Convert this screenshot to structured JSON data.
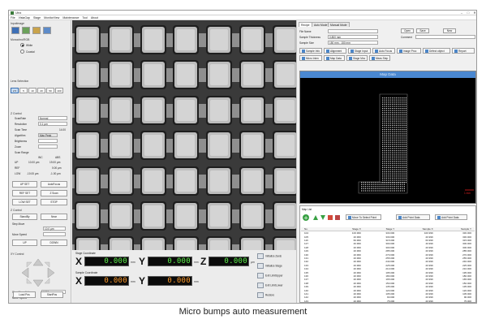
{
  "window": {
    "title": "Ulea",
    "controls": [
      "–",
      "□",
      "✕"
    ]
  },
  "menu": [
    "File",
    "VistaGap",
    "Stage",
    "MonitorView",
    "Maintenance",
    "Tool",
    "About"
  ],
  "left": {
    "input_image": "InputImage",
    "monochrome": "Monochro/RGB",
    "white": "White",
    "coaxial": "Coaxial",
    "lens_selection": "Lens Selection",
    "lenses": [
      "2.5",
      "5",
      "10",
      "20",
      "50",
      "100"
    ],
    "z_control": "Z Control",
    "scan_rate_label": "ScanRate",
    "scan_rate_value": "Normal",
    "resolution_label": "Resolution",
    "resolution_value": "0.1 µm",
    "scan_time_label": "Scan Time",
    "scan_time_value": "14.00",
    "algorithm_label": "Algorithm",
    "algorithm_value": "Max Peak",
    "brightness_label": "Brightness",
    "zoom_label": "Zoom",
    "scan_range_label": "Scan Range",
    "inc_label": "INC",
    "abs_label": "ABS",
    "up_label": "UP",
    "up_inc": "10.00 µm",
    "up_abs": "19.00 µm",
    "ref_label": "REF",
    "ref_inc": "",
    "ref_abs": "0.00 µm",
    "low_label": "LOW",
    "low_inc": "-10.00 µm",
    "low_abs": "-1.00 µm",
    "up_set": "UP SET",
    "auto_focus": "AutoFocus",
    "ref_set": "REF SET",
    "z_scan": "Z Scan",
    "low_set": "LOW SET",
    "stop": "STOP",
    "z_ctrl2": "Z Control",
    "standby": "StandBy",
    "near": "Near",
    "step_move": "Step Move",
    "step_move_value": "10.0 µm",
    "move_speed": "Move Speed",
    "up": "UP",
    "down": "DOWN",
    "xy_control": "XY Control",
    "xy_step_label": "Step Move Value",
    "xy_step_value": "1000 µm",
    "xy_speed_label": "Move Speed",
    "load_pos": "Load Pos",
    "start_pos": "StartPos"
  },
  "coords": {
    "stage_title": "Stage Coordinate",
    "sample_title": "Sample Coordinate",
    "x": "X",
    "y": "Y",
    "z": "Z",
    "stage_x": "0.000",
    "stage_y": "0.000",
    "stage_z": "0.000",
    "sample_x": "0.000",
    "sample_y": "0.000",
    "unit_mm": "mm",
    "unit_um": "µm",
    "buttons": [
      "Initialize Zaxis",
      "Initialize Stage",
      "Exit LimitUpper",
      "Exit LimitLower",
      "Restore"
    ]
  },
  "right": {
    "tabs": [
      "Recipe",
      "Auto Mode",
      "Manual Mode"
    ],
    "file_name_label": "File Name",
    "sample_thickness_label": "Sample Thickness",
    "sample_thickness_value": "0.800 mm",
    "sample_size_label": "Sample Size",
    "sample_size_value": "150 mm - 150 mm",
    "open": "Open",
    "save": "Save",
    "new": "New",
    "comment_label": "Comment",
    "toolbar1": [
      "Sample Info",
      "Alignment",
      "Stage Input",
      "Auto Focus",
      "Image Proc",
      "Defect object",
      "Report"
    ],
    "toolbar2": [
      "Micro Inten",
      "Map Data",
      "Stage Mov",
      "Meas Step"
    ],
    "map_header": "Map Data",
    "scale_label": "1 mm",
    "map_list": "Map List",
    "move_select": "Move To Select Point",
    "add_point_data": "Add Point Data",
    "add_point_data2": "Add Point Data",
    "columns": [
      "No.",
      "Stage X",
      "Stage Y",
      "Sample X",
      "Sample Y"
    ],
    "rows": [
      [
        "104",
        "100.999",
        "330.000",
        "100.999",
        "330.000"
      ],
      [
        "105",
        "20.999",
        "330.000",
        "20.999",
        "330.000"
      ],
      [
        "116",
        "60.999",
        "315.000",
        "60.999",
        "315.000"
      ],
      [
        "127",
        "40.999",
        "300.000",
        "40.999",
        "300.000"
      ],
      [
        "128",
        "20.999",
        "300.000",
        "20.999",
        "300.000"
      ],
      [
        "129",
        "20.999",
        "285.000",
        "20.999",
        "285.000"
      ],
      [
        "130",
        "20.999",
        "270.000",
        "20.999",
        "270.000"
      ],
      [
        "131",
        "20.999",
        "255.000",
        "20.999",
        "255.000"
      ],
      [
        "132",
        "20.999",
        "240.000",
        "20.999",
        "240.000"
      ],
      [
        "133",
        "20.999",
        "225.000",
        "20.999",
        "225.000"
      ],
      [
        "134",
        "20.999",
        "210.000",
        "20.999",
        "210.000"
      ],
      [
        "135",
        "20.999",
        "195.000",
        "20.999",
        "195.000"
      ],
      [
        "136",
        "20.999",
        "180.000",
        "20.999",
        "180.000"
      ],
      [
        "137",
        "20.999",
        "165.000",
        "20.999",
        "165.000"
      ],
      [
        "138",
        "20.999",
        "150.000",
        "20.999",
        "150.000"
      ],
      [
        "139",
        "20.999",
        "135.000",
        "20.999",
        "135.000"
      ],
      [
        "140",
        "20.999",
        "120.000",
        "20.999",
        "120.000"
      ],
      [
        "141",
        "20.999",
        "105.000",
        "20.999",
        "105.000"
      ],
      [
        "142",
        "20.999",
        "90.000",
        "20.999",
        "90.000"
      ],
      [
        "143",
        "20.999",
        "75.000",
        "20.999",
        "75.000"
      ]
    ]
  },
  "caption": "Micro bumps auto measurement",
  "colors": {
    "lcd_green": "#5cf04a",
    "lcd_orange": "#ff9a2b",
    "map_header": "#4a88d1",
    "scale_red": "#e02020"
  }
}
